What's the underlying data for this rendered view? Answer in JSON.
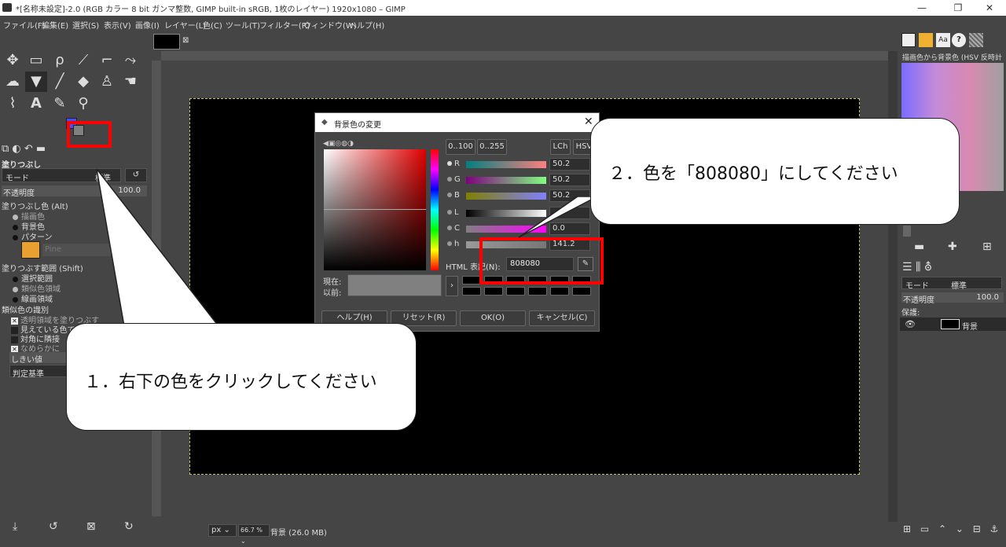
{
  "window": {
    "title": "*[名称未設定]-2.0 (RGB カラー 8 bit ガンマ整数, GIMP built-in sRGB, 1枚のレイヤー) 1920x1080 – GIMP",
    "min": "—",
    "max": "❐",
    "close": "✕"
  },
  "menu": [
    "ファイル(F)",
    "編集(E)",
    "選択(S)",
    "表示(V)",
    "画像(I)",
    "レイヤー(L)",
    "色(C)",
    "ツール(T)",
    "フィルター(R)",
    "ウィンドウ(W)",
    "ヘルプ(H)"
  ],
  "tool_options": {
    "title": "塗りつぶし",
    "mode_label": "モード",
    "mode_value": "標準",
    "opacity_label": "不透明度",
    "opacity_value": "100.0",
    "fill_color_label": "塗りつぶし色 (Alt)",
    "fill_options": [
      "描画色",
      "背景色",
      "パターン"
    ],
    "fill_selected": 0,
    "pattern_name": "Pine",
    "area_label": "塗りつぶす範囲 (Shift)",
    "area_options": [
      "選択範囲",
      "類似色領域",
      "線画領域"
    ],
    "area_selected": 1,
    "similar_label": "類似色の識別",
    "similar_options": [
      {
        "label": "透明領域を塗りつぶす",
        "checked": true
      },
      {
        "label": "見えている色で",
        "checked": false
      },
      {
        "label": "対角に隣接",
        "checked": false
      },
      {
        "label": "なめらかに",
        "checked": true
      }
    ],
    "threshold_label": "しきい値",
    "criterion_label": "判定基準"
  },
  "dialog": {
    "title": "背景色の変更",
    "range_btns": [
      "0..100",
      "0..255"
    ],
    "model_btns": [
      "LCh",
      "HSV"
    ],
    "channels": [
      {
        "label": "R",
        "value": "50.2",
        "grad": "linear-gradient(90deg,#008080,#ff8080)"
      },
      {
        "label": "G",
        "value": "50.2",
        "grad": "linear-gradient(90deg,#800080,#80ff80)"
      },
      {
        "label": "B",
        "value": "50.2",
        "grad": "linear-gradient(90deg,#808000,#8080ff)"
      },
      {
        "label": "L",
        "value": "",
        "grad": "linear-gradient(90deg,#000,#fff)"
      },
      {
        "label": "C",
        "value": "0.0",
        "grad": "linear-gradient(90deg,#808080,#ff00ff)"
      },
      {
        "label": "h",
        "value": "141.2",
        "grad": "linear-gradient(90deg,#999,#777)"
      }
    ],
    "html_label": "HTML 表記(N):",
    "html_value": "808080",
    "current_label": "現在:",
    "previous_label": "以前:",
    "buttons": [
      "ヘルプ(H)",
      "リセット(R)",
      "OK(O)",
      "キャンセル(C)"
    ]
  },
  "callouts": {
    "step1": "１．右下の色をクリックしてください",
    "step2": "２．色を「808080」にしてください"
  },
  "right_panel": {
    "gradient_name": "描画色から背景色 (HSV 反時計",
    "mode_label": "モード",
    "mode_value": "標準",
    "opacity_label": "不透明度",
    "opacity_value": "100.0",
    "protect_label": "保護:",
    "layer_name": "背景"
  },
  "status": {
    "unit": "px",
    "zoom": "66.7 %",
    "info": "背景 (26.0 MB)"
  },
  "colors": {
    "fg": "#4c4cff",
    "bg": "#808080",
    "highlight": "#ff0000"
  }
}
